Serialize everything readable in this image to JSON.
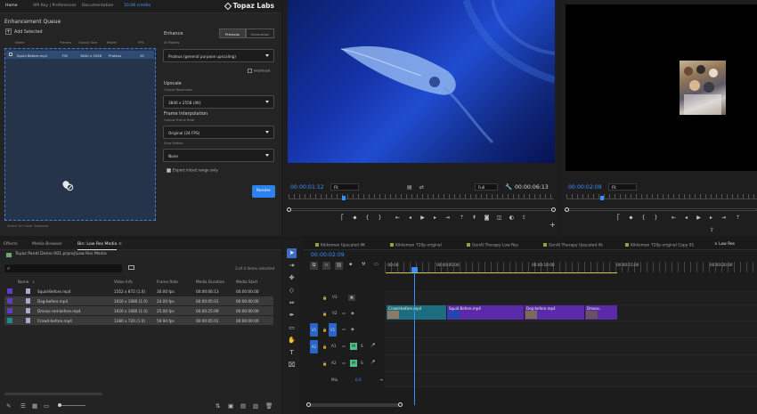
{
  "topaz": {
    "nav": [
      "Home",
      "API Key | Preferences",
      "Documentation",
      "10.06 credits"
    ],
    "logo": "Topaz Labs",
    "queue_title": "Enhancement Queue",
    "add_label": "Add Selected",
    "queue_cols": [
      "Name",
      "Frames",
      "Output Size",
      "Model",
      "FPS"
    ],
    "queue_row": {
      "name": "Squid Before.mp4",
      "frames": "FW",
      "size": "3840 x 2558",
      "model": "Proteus",
      "fps": "30"
    },
    "queue_footer": "Select All   Clear Selected",
    "enhance_title": "Enhance",
    "mode_previous": "Previous",
    "mode_generation": "Generation",
    "ai_models_label": "AI Models",
    "ai_model": "Proteus (general purpose upscaling)",
    "interlaced": "Interlaced",
    "upscale_title": "Upscale",
    "output_res_label": "Output Resolution",
    "output_res": "3840 x 2558 (4K)",
    "fi_title": "Frame Interpolation",
    "output_fr_label": "Output Frame Rate",
    "output_fr": "Original (24 FPS)",
    "slowmo_label": "Slow Motion",
    "slowmo": "None",
    "export_inout": "Export in/out range only",
    "render": "Render"
  },
  "program": {
    "timecode": "00:00:01:12",
    "fit": "Fit",
    "quality": "Full",
    "duration": "00:00:06:13"
  },
  "source": {
    "timecode": "00:00:02:09",
    "fit": "Fit"
  },
  "project": {
    "tabs": [
      "Effects",
      "Media Browser",
      "Bin: Low Res Media"
    ],
    "path": "Toyaz Pandl Demo 001.prproj\\Low Res Media",
    "count": "3 of 4 items selected",
    "columns": [
      "Name",
      "Video Info",
      "Frame Rate",
      "Media Duration",
      "Media Start"
    ],
    "rows": [
      {
        "name": "Squid-Before.mp4",
        "info": "1552 x 872 (1.0)",
        "rate": "30.00 fps",
        "dur": "00:00:06:13",
        "start": "00:00:00:00",
        "color": "#5b3fc0",
        "selected": false
      },
      {
        "name": "Dog-before.mp4",
        "info": "1920 x 1080 (1.0)",
        "rate": "24.00 fps",
        "dur": "00:00:05:01",
        "start": "00:00:00:00",
        "color": "#5b3fc0",
        "selected": true
      },
      {
        "name": "Dmoos-red-before.mp4",
        "info": "1920 x 1080 (1.0)",
        "rate": "25.00 fps",
        "dur": "00:00:25:09",
        "start": "00:00:00:00",
        "color": "#5b3fc0",
        "selected": true
      },
      {
        "name": "Crowd-before.mp4",
        "info": "1280 x 720 (1.0)",
        "rate": "59.94 fps",
        "dur": "00:00:05:01",
        "start": "00:00:00:00",
        "color": "#1e8a8a",
        "selected": true
      }
    ]
  },
  "timeline": {
    "tabs": [
      "Kikkoman Upscaled 4K",
      "Kikkoman 720p original",
      "GenAI Therapy Low Res",
      "GenAI Therapy Upscaled 4k",
      "Kikkoman 720p original Copy 01",
      "Low Res"
    ],
    "timecode": "00:00:02:09",
    "ruler": [
      ":00:00",
      "00:00:05:00",
      "00:00:10:00",
      "00:00:15:00",
      "00:00:20:00"
    ],
    "tracks": [
      "V3",
      "V2",
      "V1",
      "A1",
      "A2",
      "Mix"
    ],
    "mix_value": "0.0",
    "clips": [
      {
        "name": "Crowd-before.mp4",
        "color": "#1c6e7e"
      },
      {
        "name": "Squid Before.mp4",
        "color": "#5a2aa8"
      },
      {
        "name": "Dog-before.mp4",
        "color": "#5a2aa8"
      },
      {
        "name": "Dmoos..",
        "color": "#5a2aa8"
      }
    ]
  },
  "colors": {
    "accent": "#2a82ee",
    "timecode": "#3d8fff"
  }
}
